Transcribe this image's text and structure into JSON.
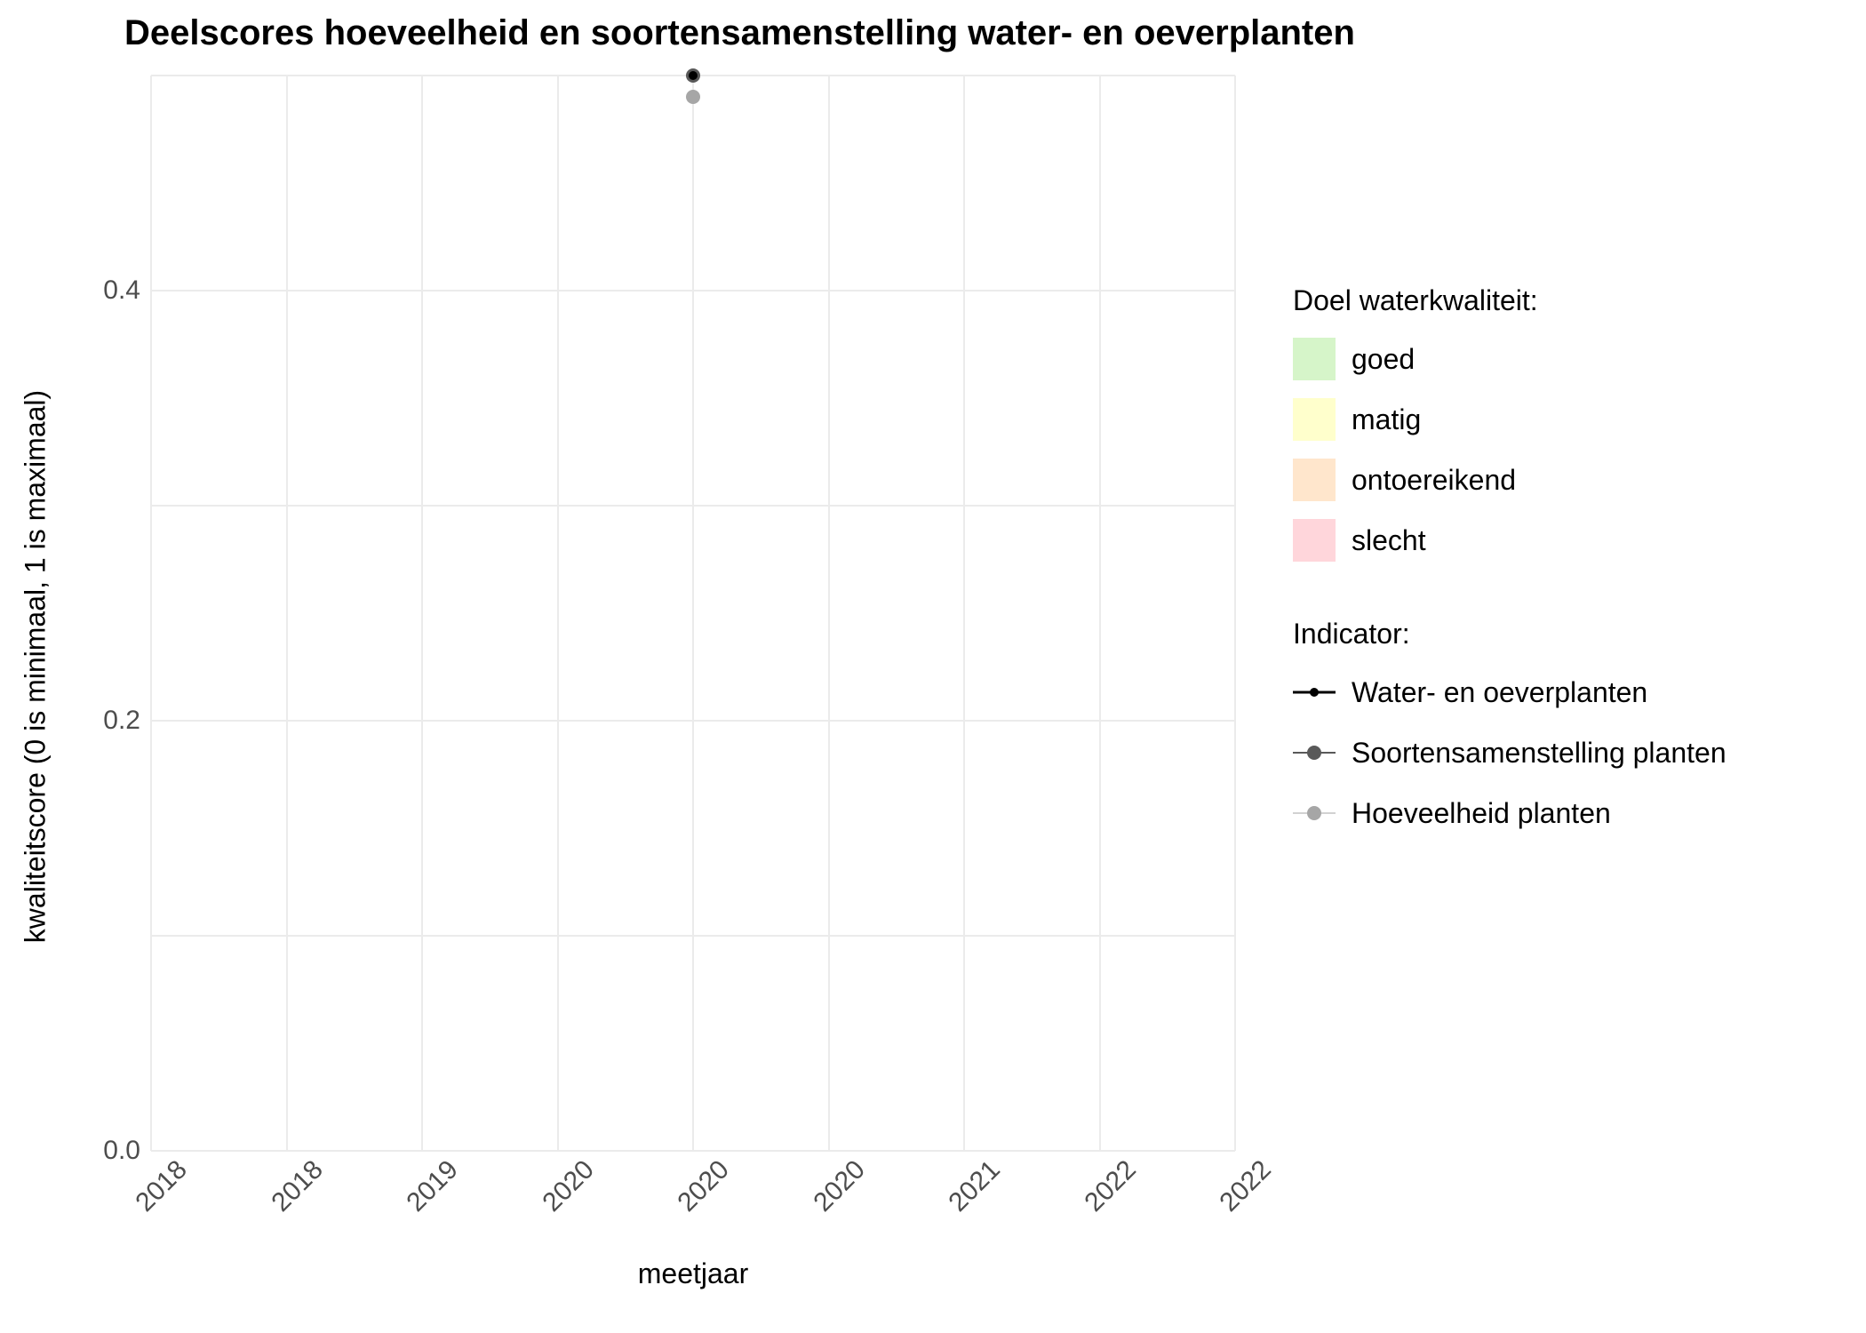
{
  "chart_data": {
    "type": "scatter",
    "title": "Deelscores hoeveelheid en soortensamenstelling water- en oeverplanten",
    "xlabel": "meetjaar",
    "ylabel": "kwaliteitscore (0 is minimaal, 1 is maximaal)",
    "xlim": [
      2018,
      2022
    ],
    "ylim": [
      0.0,
      0.5
    ],
    "x_ticks": [
      "2018",
      "2018",
      "2019",
      "2020",
      "2020",
      "2020",
      "2021",
      "2022",
      "2022"
    ],
    "y_ticks": [
      0.0,
      0.2,
      0.4
    ],
    "series": [
      {
        "name": "Water- en oeverplanten",
        "color": "#000000",
        "points": [
          {
            "x": 2020,
            "y": 0.5
          }
        ]
      },
      {
        "name": "Soortensamenstelling planten",
        "color": "#595959",
        "points": [
          {
            "x": 2020,
            "y": 0.5
          }
        ]
      },
      {
        "name": "Hoeveelheid planten",
        "color": "#a6a6a6",
        "points": [
          {
            "x": 2020,
            "y": 0.49
          }
        ]
      }
    ],
    "legend_bands": {
      "title": "Doel waterkwaliteit:",
      "items": [
        {
          "label": "goed",
          "color": "#d6f5c9"
        },
        {
          "label": "matig",
          "color": "#ffffcc"
        },
        {
          "label": "ontoereikend",
          "color": "#ffe6cc"
        },
        {
          "label": "slecht",
          "color": "#ffd6db"
        }
      ]
    },
    "legend_indicators": {
      "title": "Indicator:",
      "items": [
        {
          "label": "Water- en oeverplanten",
          "color": "#000000",
          "size": 10,
          "line_thickness": 3
        },
        {
          "label": "Soortensamenstelling planten",
          "color": "#595959",
          "size": 16,
          "line_thickness": 2
        },
        {
          "label": "Hoeveelheid planten",
          "color": "#a6a6a6",
          "size": 16,
          "line_thickness": 1
        }
      ]
    }
  }
}
